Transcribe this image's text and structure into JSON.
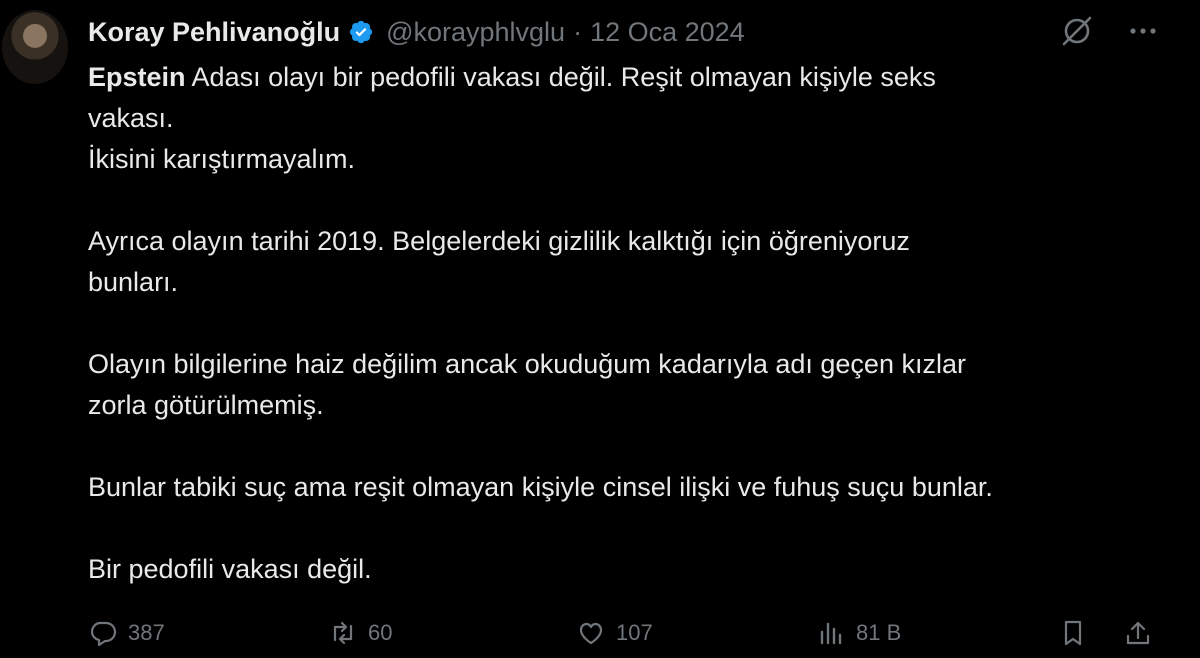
{
  "author": {
    "name": "Koray Pehlivanoğlu",
    "handle": "@korayphlvglu",
    "separator": "·",
    "date": "12 Oca 2024"
  },
  "tweet": {
    "first_word": "Epstein",
    "line1_rest": " Adası olayı bir pedofili vakası değil. Reşit olmayan kişiyle seks",
    "line2": "vakası.",
    "line3": "İkisini karıştırmayalım.",
    "para2_line1": "Ayrıca olayın tarihi 2019. Belgelerdeki gizlilik kalktığı için öğreniyoruz",
    "para2_line2": "bunları.",
    "para3_line1": "Olayın bilgilerine haiz değilim ancak okuduğum kadarıyla adı geçen kızlar",
    "para3_line2": "zorla götürülmemiş.",
    "para4_line1": "Bunlar tabiki suç ama reşit olmayan kişiyle cinsel ilişki ve fuhuş suçu bunlar.",
    "para5_line1": "Bir pedofili vakası değil."
  },
  "metrics": {
    "replies": "387",
    "reposts": "60",
    "likes": "107",
    "views": "81 B"
  },
  "icons": {
    "verified": "verified-badge-icon",
    "grok": "grok-icon",
    "more": "more-icon",
    "reply": "reply-icon",
    "repost": "repost-icon",
    "like": "like-icon",
    "views": "views-icon",
    "bookmark": "bookmark-icon",
    "share": "share-icon"
  },
  "colors": {
    "background": "#000000",
    "text": "#e7e9ea",
    "muted": "#71767b",
    "verified": "#1d9bf0"
  }
}
